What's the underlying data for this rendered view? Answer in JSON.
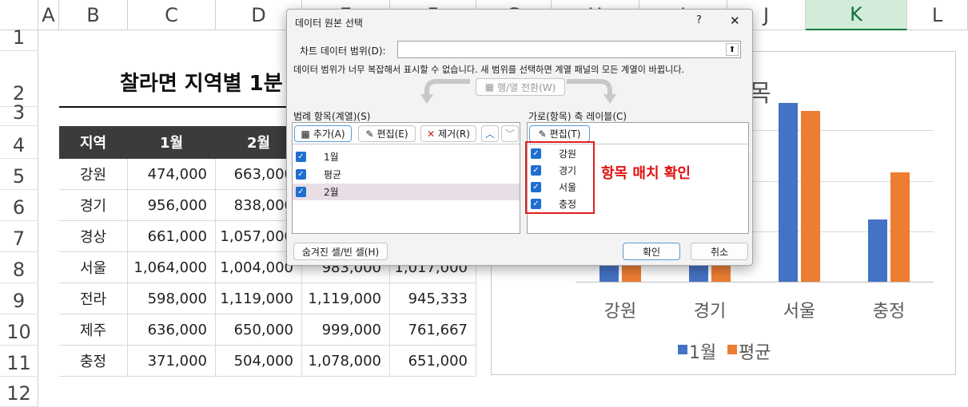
{
  "sheet": {
    "columns": [
      "A",
      "B",
      "C",
      "D",
      "E",
      "F",
      "G",
      "H",
      "I",
      "J",
      "K",
      "L"
    ],
    "rows": [
      "1",
      "2",
      "3",
      "4",
      "5",
      "6",
      "7",
      "8",
      "9",
      "10",
      "11",
      "12"
    ],
    "title": "찰라면 지역별 1분",
    "table_headers": [
      "지역",
      "1월",
      "2월"
    ],
    "table": [
      [
        "강원",
        "474,000",
        "663,000",
        "",
        ""
      ],
      [
        "경기",
        "956,000",
        "838,000",
        "",
        ""
      ],
      [
        "경상",
        "661,000",
        "1,057,000",
        "",
        ""
      ],
      [
        "서울",
        "1,064,000",
        "1,004,000",
        "983,000",
        "1,017,000"
      ],
      [
        "전라",
        "598,000",
        "1,119,000",
        "1,119,000",
        "945,333"
      ],
      [
        "제주",
        "636,000",
        "650,000",
        "999,000",
        "761,667"
      ],
      [
        "충정",
        "371,000",
        "504,000",
        "1,078,000",
        "651,000"
      ]
    ]
  },
  "chart_data": {
    "type": "bar",
    "title": "목",
    "categories": [
      "강원",
      "경기",
      "서울",
      "충정"
    ],
    "series": [
      {
        "name": "1월",
        "color": "#4472c4",
        "values": [
          474000,
          956000,
          1064000,
          371000
        ]
      },
      {
        "name": "평균",
        "color": "#ed7d31",
        "values": [
          663000,
          938000,
          1017000,
          651000
        ]
      }
    ],
    "ylim": [
      0,
      1200000
    ]
  },
  "dialog": {
    "title": "데이터 원본 선택",
    "help": "?",
    "close": "✕",
    "range_label": "차트 데이터 범위(D):",
    "range_value": "",
    "message": "데이터 범위가 너무 복잡해서 표시할 수 없습니다. 새 범위를 선택하면 계열 패널의 모든 계열이 바뀝니다.",
    "switch_btn": "행/열 전환(W)",
    "legend_label": "범례 항목(계열)(S)",
    "add_btn": "추가(A)",
    "edit_btn": "편집(E)",
    "remove_btn": "제거(R)",
    "series_items": [
      "1월",
      "평균",
      "2월"
    ],
    "axis_label": "가로(항목) 축 레이블(C)",
    "axis_edit_btn": "편집(T)",
    "axis_items": [
      "강원",
      "경기",
      "서울",
      "충정"
    ],
    "hidden_btn": "숨겨진 셀/빈 셀(H)",
    "ok_btn": "확인",
    "cancel_btn": "취소"
  },
  "annotation": "항목 매치 확인"
}
